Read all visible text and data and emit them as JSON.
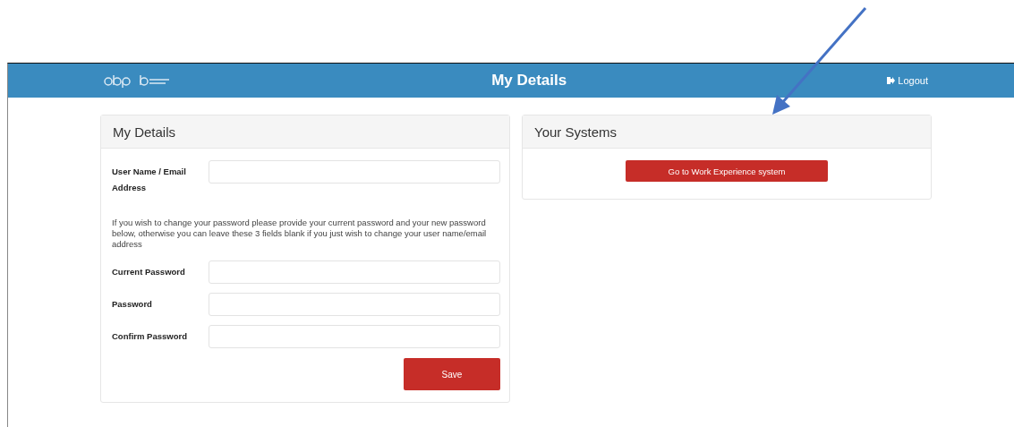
{
  "header": {
    "title": "My Details",
    "logout": "Logout"
  },
  "details_panel": {
    "title": "My Details",
    "username_label": "User Name / Email Address",
    "note": "If you wish to change your password please provide your current password and your new password below, otherwise you can leave these 3 fields blank if you just wish to change your user name/email address",
    "password_fields": [
      {
        "label": "Current Password"
      },
      {
        "label": "Password"
      },
      {
        "label": "Confirm Password"
      }
    ],
    "save": "Save"
  },
  "systems_panel": {
    "title": "Your Systems",
    "button": "Go to Work Experience system"
  }
}
